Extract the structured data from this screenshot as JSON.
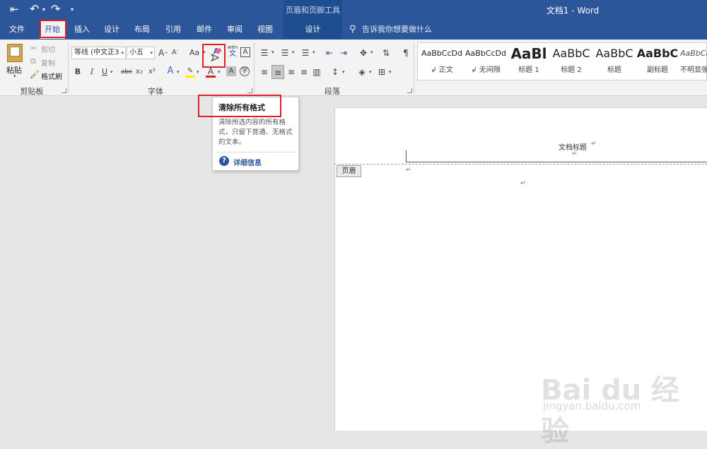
{
  "titlebar": {
    "back_icon": "back-icon",
    "undo_icon": "undo-icon",
    "redo_icon": "redo-icon",
    "customize_icon": "customize-icon",
    "context_group": "页眉和页脚工具",
    "document_title": "文档1  -  Word"
  },
  "tabs": [
    {
      "label": "文件"
    },
    {
      "label": "开始"
    },
    {
      "label": "插入"
    },
    {
      "label": "设计"
    },
    {
      "label": "布局"
    },
    {
      "label": "引用"
    },
    {
      "label": "邮件"
    },
    {
      "label": "审阅"
    },
    {
      "label": "视图"
    },
    {
      "label": "设计"
    }
  ],
  "search": {
    "placeholder": "告诉我你想要做什么"
  },
  "clipboard": {
    "paste_label": "粘贴",
    "cut_label": "剪切",
    "copy_label": "复制",
    "format_painter_label": "格式刷",
    "group_label": "剪贴板"
  },
  "font": {
    "font_name": "等线 (中文正3",
    "font_size": "小五",
    "grow_icon": "A^",
    "shrink_icon": "A˅",
    "case_label": "Aa",
    "phonetic_icon": "wén",
    "bold": "B",
    "italic": "I",
    "underline": "U",
    "strike": "abc",
    "sub": "x₂",
    "sup": "x²",
    "group_label": "字体"
  },
  "paragraph": {
    "group_label": "段落"
  },
  "styles": [
    {
      "preview": "AaBbCcDd",
      "name": "↲ 正文"
    },
    {
      "preview": "AaBbCcDd",
      "name": "↲ 无间隔"
    },
    {
      "preview": "AaBl",
      "name": "标题 1"
    },
    {
      "preview": "AaBbC",
      "name": "标题 2"
    },
    {
      "preview": "AaBbC",
      "name": "标题"
    },
    {
      "preview": "AaBbC",
      "name": "副标题"
    },
    {
      "preview": "AaBbCcD",
      "name": "不明显强"
    }
  ],
  "tooltip": {
    "title": "清除所有格式",
    "description": "清除所选内容的所有格式，只留下普通、无格式的文本。",
    "link": "详细信息"
  },
  "document": {
    "header_text": "文档标题",
    "header_tag": "页眉",
    "para_mark": "↵"
  },
  "watermark": {
    "logo": "Bai du 经验",
    "url": "jingyan.baidu.com"
  },
  "colors": {
    "accent": "#2b579a",
    "highlight": "#e21f26"
  }
}
